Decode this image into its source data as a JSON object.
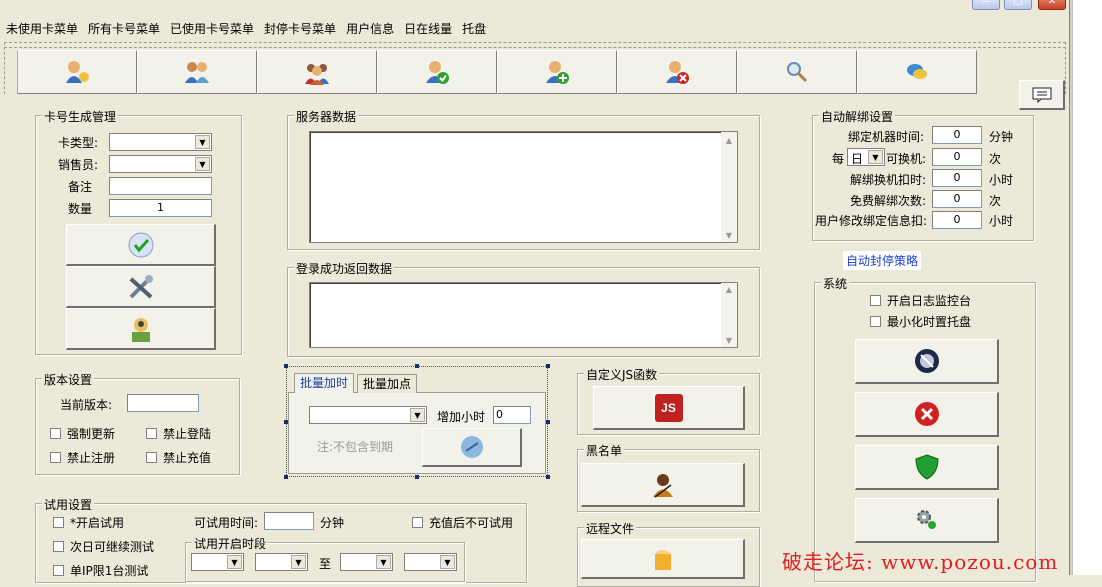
{
  "menu": [
    "未使用卡菜单",
    "所有卡号菜单",
    "已使用卡号菜单",
    "封停卡号菜单",
    "用户信息",
    "日在线量",
    "托盘"
  ],
  "toolbar_icons": [
    "users-icon",
    "user-pair-icon",
    "user-group-icon",
    "user-check-icon",
    "user-add-icon",
    "user-delete-icon",
    "search-icon",
    "chat-icon"
  ],
  "card_gen": {
    "title": "卡号生成管理",
    "type_label": "卡类型:",
    "seller_label": "销售员:",
    "note_label": "备注",
    "qty_label": "数量",
    "qty_value": "1"
  },
  "server_data": {
    "title": "服务器数据"
  },
  "login_return": {
    "title": "登录成功返回数据"
  },
  "version": {
    "title": "版本设置",
    "current_label": "当前版本:",
    "force_update": "强制更新",
    "forbid_login": "禁止登陆",
    "forbid_register": "禁止注册",
    "forbid_recharge": "禁止充值"
  },
  "batch": {
    "tab1": "批量加时",
    "tab2": "批量加点",
    "add_hours_label": "增加小时",
    "add_hours_value": "0",
    "note": "注:不包含到期"
  },
  "custom_js": {
    "title": "自定义JS函数",
    "icon_text": "JS"
  },
  "blacklist": {
    "title": "黑名单"
  },
  "remote_file": {
    "title": "远程文件"
  },
  "trial": {
    "title": "试用设置",
    "enable": "*开启试用",
    "next_day": "次日可继续测试",
    "single_machine": "单IP限1台测试",
    "trial_time_label": "可试用时间:",
    "minutes": "分钟",
    "no_trial_after_recharge": "充值后不可试用",
    "period_label": "试用开启时段",
    "to": "至"
  },
  "auto_unbind": {
    "title": "自动解绑设置",
    "bind_time_label": "绑定机器时间:",
    "bind_time_value": "0",
    "bind_time_unit": "分钟",
    "per_label": "每",
    "per_value": "日",
    "can_change_label": "可换机:",
    "can_change_value": "0",
    "times_unit": "次",
    "unbind_deduct_label": "解绑换机扣时:",
    "unbind_deduct_value": "0",
    "hours_unit": "小时",
    "free_unbind_label": "免费解绑次数:",
    "free_unbind_value": "0",
    "free_unit": "次",
    "modify_deduct_label": "用户修改绑定信息扣:",
    "modify_deduct_value": "0",
    "modify_unit": "小时"
  },
  "auto_ban_link": "自动封停策略",
  "system": {
    "title": "系统",
    "log_monitor": "开启日志监控台",
    "minimize_tray": "最小化时置托盘"
  },
  "watermark": "破走论坛: www.pozou.com"
}
